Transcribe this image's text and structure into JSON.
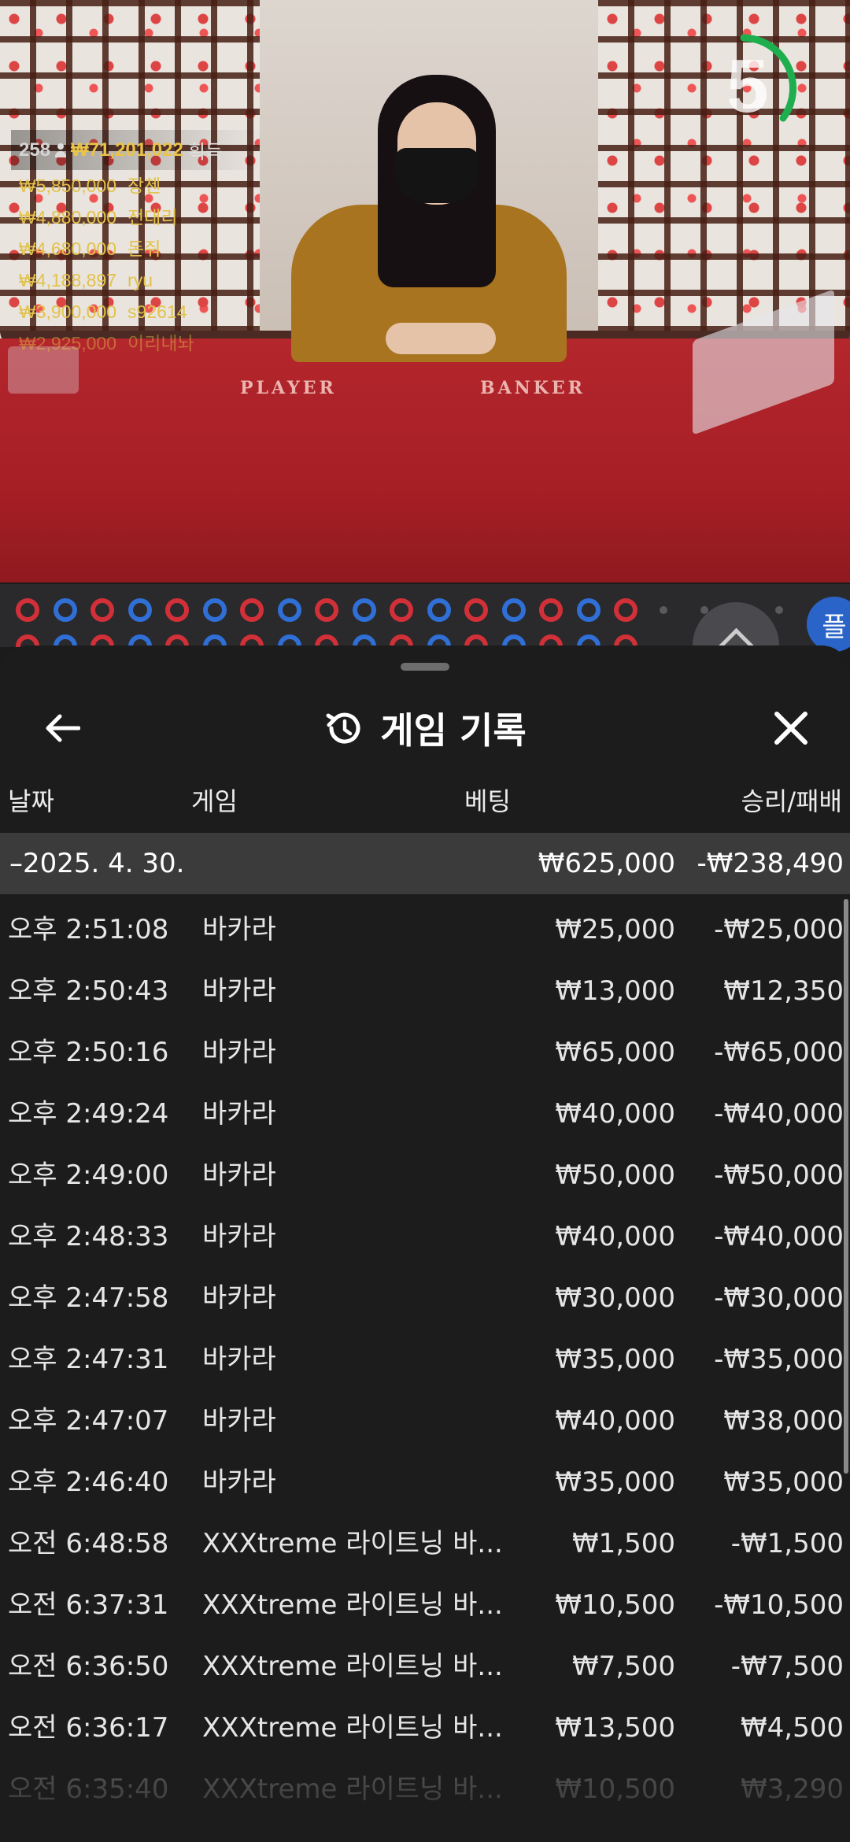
{
  "video": {
    "countdown": "5",
    "felt_player": "PLAYER",
    "felt_banker": "BANKER",
    "winners_header": {
      "count": "258",
      "total": "₩71,201,022",
      "label": "획득"
    },
    "winners": [
      {
        "amount": "₩5,850,000",
        "name": "장첸"
      },
      {
        "amount": "₩4,880,000",
        "name": "전대리"
      },
      {
        "amount": "₩4,680,000",
        "name": "돈줘"
      },
      {
        "amount": "₩4,188,897",
        "name": "ryu"
      },
      {
        "amount": "₩3,900,000",
        "name": "s92614"
      },
      {
        "amount": "₩2,925,000",
        "name": "이리내놔"
      }
    ]
  },
  "road": {
    "row1": [
      "r",
      "b",
      "r",
      "b",
      "r",
      "b",
      "r",
      "b",
      "r",
      "b",
      "r",
      "b",
      "r",
      "b",
      "r",
      "b",
      "r"
    ],
    "colors": {
      "banker": "#d23038",
      "player": "#2f6fd6"
    },
    "side_tab": "플"
  },
  "sheet": {
    "title": "게임 기록",
    "columns": {
      "date": "날짜",
      "game": "게임",
      "bet": "베팅",
      "result": "승리/패배"
    },
    "date_group": {
      "label": "–2025. 4. 30.",
      "bet": "₩625,000",
      "result": "-₩238,490"
    },
    "rows": [
      {
        "time": "오후 2:51:08",
        "game": "바카라",
        "bet": "₩25,000",
        "result": "-₩25,000"
      },
      {
        "time": "오후 2:50:43",
        "game": "바카라",
        "bet": "₩13,000",
        "result": "₩12,350"
      },
      {
        "time": "오후 2:50:16",
        "game": "바카라",
        "bet": "₩65,000",
        "result": "-₩65,000"
      },
      {
        "time": "오후 2:49:24",
        "game": "바카라",
        "bet": "₩40,000",
        "result": "-₩40,000"
      },
      {
        "time": "오후 2:49:00",
        "game": "바카라",
        "bet": "₩50,000",
        "result": "-₩50,000"
      },
      {
        "time": "오후 2:48:33",
        "game": "바카라",
        "bet": "₩40,000",
        "result": "-₩40,000"
      },
      {
        "time": "오후 2:47:58",
        "game": "바카라",
        "bet": "₩30,000",
        "result": "-₩30,000"
      },
      {
        "time": "오후 2:47:31",
        "game": "바카라",
        "bet": "₩35,000",
        "result": "-₩35,000"
      },
      {
        "time": "오후 2:47:07",
        "game": "바카라",
        "bet": "₩40,000",
        "result": "₩38,000"
      },
      {
        "time": "오후 2:46:40",
        "game": "바카라",
        "bet": "₩35,000",
        "result": "₩35,000"
      },
      {
        "time": "오전 6:48:58",
        "game": "XXXtreme 라이트닝 바...",
        "bet": "₩1,500",
        "result": "-₩1,500"
      },
      {
        "time": "오전 6:37:31",
        "game": "XXXtreme 라이트닝 바...",
        "bet": "₩10,500",
        "result": "-₩10,500"
      },
      {
        "time": "오전 6:36:50",
        "game": "XXXtreme 라이트닝 바...",
        "bet": "₩7,500",
        "result": "-₩7,500"
      },
      {
        "time": "오전 6:36:17",
        "game": "XXXtreme 라이트닝 바...",
        "bet": "₩13,500",
        "result": "₩4,500"
      },
      {
        "time": "오전 6:35:40",
        "game": "XXXtreme 라이트닝 바...",
        "bet": "₩10,500",
        "result": "₩3,290"
      }
    ]
  }
}
